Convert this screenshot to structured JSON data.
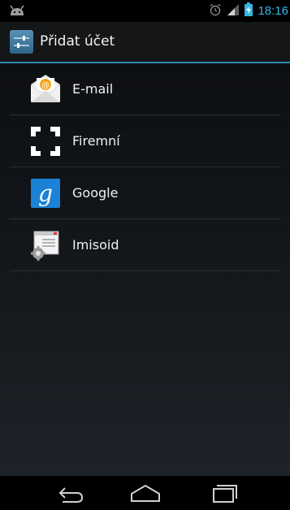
{
  "status_bar": {
    "time": "18:16",
    "icons": [
      "android-debug-icon",
      "alarm-icon",
      "signal-icon",
      "battery-charging-icon"
    ],
    "time_color": "#33b5e5"
  },
  "action_bar": {
    "title": "Přidat účet",
    "icon": "settings-sliders-icon",
    "accent": "#2e8cb0"
  },
  "accounts": [
    {
      "label": "E-mail",
      "icon": "email-envelope-icon"
    },
    {
      "label": "Firemní",
      "icon": "corporate-corners-icon"
    },
    {
      "label": "Google",
      "icon": "google-g-icon"
    },
    {
      "label": "Imisoid",
      "icon": "imisoid-gear-icon"
    }
  ],
  "nav_bar": {
    "buttons": [
      "back-icon",
      "home-icon",
      "recents-icon"
    ]
  }
}
